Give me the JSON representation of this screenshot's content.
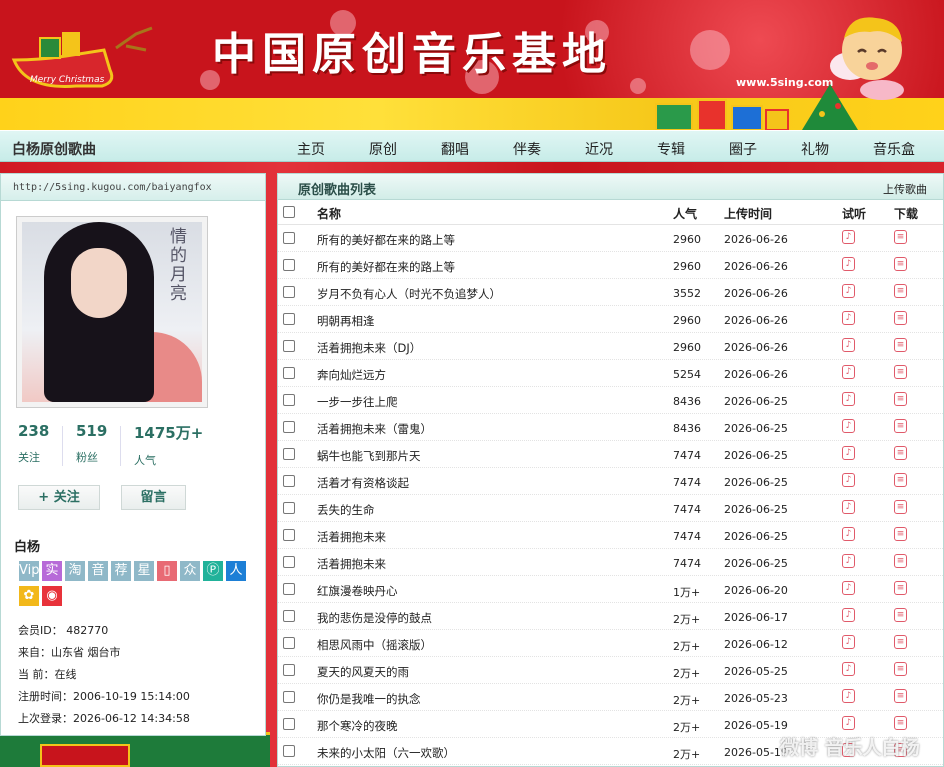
{
  "banner": {
    "title": "中国原创音乐基地",
    "site_url": "www.5sing.com",
    "sleigh_text": "Merry Christmas"
  },
  "nav": {
    "brand": "白杨原创歌曲",
    "items": [
      "主页",
      "原创",
      "翻唱",
      "伴奏",
      "近况",
      "专辑",
      "圈子",
      "礼物",
      "音乐盒"
    ]
  },
  "profile": {
    "url": "http://5sing.kugou.com/baiyangfox",
    "photo_caption": "情的月亮",
    "stats": [
      {
        "value": "238",
        "label": "关注"
      },
      {
        "value": "519",
        "label": "粉丝"
      },
      {
        "value": "1475万+",
        "label": "人气"
      }
    ],
    "follow_button": "+ 关注",
    "message_button": "留言",
    "name": "白杨",
    "badges": [
      {
        "text": "Vip",
        "color": "#8fb8c8"
      },
      {
        "text": "实",
        "color": "#b76ad8"
      },
      {
        "text": "淘",
        "color": "#8fb8c8"
      },
      {
        "text": "音",
        "color": "#8fb8c8"
      },
      {
        "text": "荐",
        "color": "#8fb8c8"
      },
      {
        "text": "星",
        "color": "#8fb8c8"
      },
      {
        "text": "▯",
        "color": "#e86a74"
      },
      {
        "text": "众",
        "color": "#8fb8c8"
      },
      {
        "text": "Ⓟ",
        "color": "#21b29a"
      },
      {
        "text": "人",
        "color": "#1d7fd6"
      },
      {
        "text": "✿",
        "color": "#f2b81a"
      },
      {
        "text": "◉",
        "color": "#e8323a"
      }
    ],
    "member_id": "会员ID： 482770",
    "from": "来自：山东省 烟台市",
    "current": "当   前：在线",
    "registered": "注册时间：2006-10-19 15:14:00",
    "last_login": "上次登录：2026-06-12 14:34:58"
  },
  "songs": {
    "title": "原创歌曲列表",
    "upload_link": "上传歌曲",
    "columns": {
      "name": "名称",
      "popularity": "人气",
      "upload_time": "上传时间",
      "listen": "试听",
      "download": "下载"
    },
    "rows": [
      {
        "name": "所有的美好都在来的路上等",
        "popularity": "2960",
        "date": "2026-06-26"
      },
      {
        "name": "所有的美好都在来的路上等",
        "popularity": "2960",
        "date": "2026-06-26"
      },
      {
        "name": "岁月不负有心人（时光不负追梦人）",
        "popularity": "3552",
        "date": "2026-06-26"
      },
      {
        "name": "明朝再相逢",
        "popularity": "2960",
        "date": "2026-06-26"
      },
      {
        "name": "活着拥抱未来（DJ）",
        "popularity": "2960",
        "date": "2026-06-26"
      },
      {
        "name": "奔向灿烂远方",
        "popularity": "5254",
        "date": "2026-06-26"
      },
      {
        "name": "一步一步往上爬",
        "popularity": "8436",
        "date": "2026-06-25"
      },
      {
        "name": "活着拥抱未来（雷鬼）",
        "popularity": "8436",
        "date": "2026-06-25"
      },
      {
        "name": "蜗牛也能飞到那片天",
        "popularity": "7474",
        "date": "2026-06-25"
      },
      {
        "name": "活着才有资格谈起",
        "popularity": "7474",
        "date": "2026-06-25"
      },
      {
        "name": "丢失的生命",
        "popularity": "7474",
        "date": "2026-06-25"
      },
      {
        "name": "活着拥抱未来",
        "popularity": "7474",
        "date": "2026-06-25"
      },
      {
        "name": "活着拥抱未来",
        "popularity": "7474",
        "date": "2026-06-25"
      },
      {
        "name": "红旗漫卷映丹心",
        "popularity": "1万+",
        "date": "2026-06-20"
      },
      {
        "name": "我的悲伤是没停的鼓点",
        "popularity": "2万+",
        "date": "2026-06-17"
      },
      {
        "name": "相思风雨中（摇滚版）",
        "popularity": "2万+",
        "date": "2026-06-12"
      },
      {
        "name": "夏天的风夏天的雨",
        "popularity": "2万+",
        "date": "2026-05-25"
      },
      {
        "name": "你仍是我唯一的执念",
        "popularity": "2万+",
        "date": "2026-05-23"
      },
      {
        "name": "那个寒冷的夜晚",
        "popularity": "2万+",
        "date": "2026-05-19"
      },
      {
        "name": "未来的小太阳（六一欢歌）",
        "popularity": "2万+",
        "date": "2026-05-19"
      }
    ]
  },
  "watermark": "微博 音乐人白杨",
  "colors": {
    "banner_red": "#c8141c",
    "nav_teal": "#c7ece8",
    "accent_green": "#2b6f63",
    "icon_pink": "#e05a6a"
  }
}
